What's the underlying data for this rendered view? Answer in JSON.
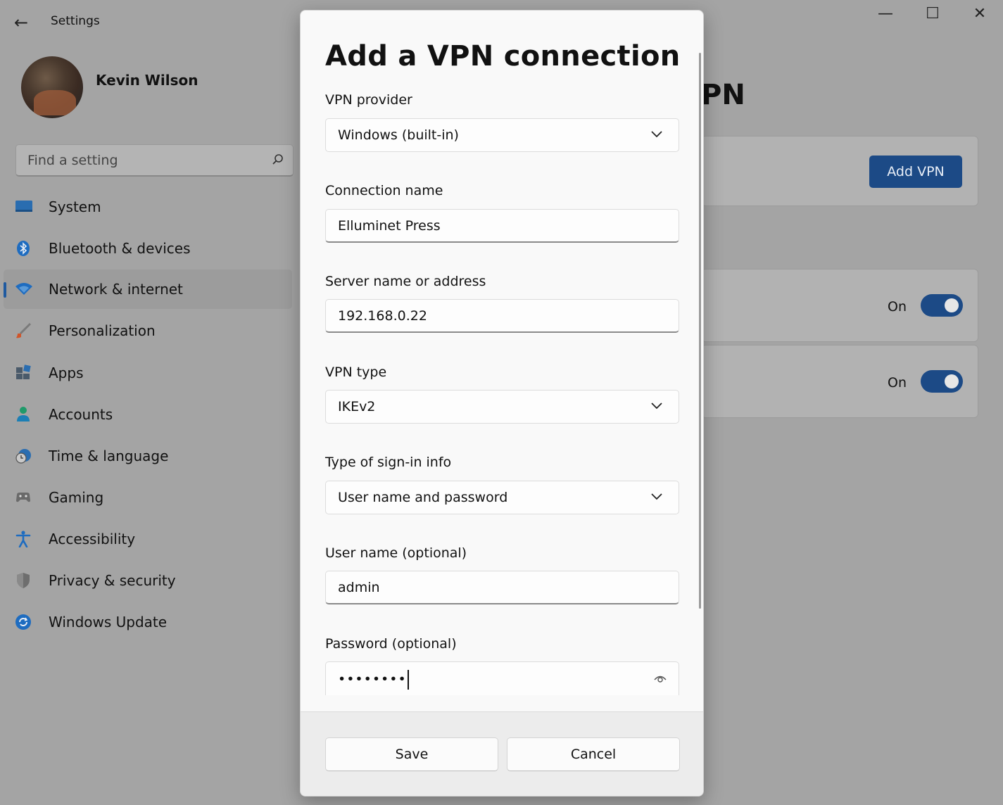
{
  "window": {
    "back_glyph": "←",
    "title": "Settings",
    "controls": {
      "minimize": "—",
      "maximize": "☐",
      "close": "✕"
    }
  },
  "profile": {
    "name": "Kevin Wilson"
  },
  "search": {
    "placeholder": "Find a setting",
    "icon": "search-icon"
  },
  "sidebar": {
    "items": [
      {
        "label": "System",
        "icon": "system-icon"
      },
      {
        "label": "Bluetooth & devices",
        "icon": "bluetooth-icon"
      },
      {
        "label": "Network & internet",
        "icon": "wifi-icon",
        "selected": true
      },
      {
        "label": "Personalization",
        "icon": "brush-icon"
      },
      {
        "label": "Apps",
        "icon": "apps-icon"
      },
      {
        "label": "Accounts",
        "icon": "account-icon"
      },
      {
        "label": "Time & language",
        "icon": "clock-globe-icon"
      },
      {
        "label": "Gaming",
        "icon": "gamepad-icon"
      },
      {
        "label": "Accessibility",
        "icon": "accessibility-icon"
      },
      {
        "label": "Privacy & security",
        "icon": "shield-icon"
      },
      {
        "label": "Windows Update",
        "icon": "update-icon"
      }
    ]
  },
  "background_page": {
    "title_fragment": "PN",
    "add_vpn_label": "Add VPN",
    "toggles": [
      {
        "label": "On",
        "on": true
      },
      {
        "label": "On",
        "on": true
      }
    ]
  },
  "dialog": {
    "title": "Add a VPN connection",
    "vpn_provider": {
      "label": "VPN provider",
      "value": "Windows (built-in)"
    },
    "connection_name": {
      "label": "Connection name",
      "value": "Elluminet Press"
    },
    "server": {
      "label": "Server name or address",
      "value": "192.168.0.22"
    },
    "vpn_type": {
      "label": "VPN type",
      "value": "IKEv2"
    },
    "signin_type": {
      "label": "Type of sign-in info",
      "value": "User name and password"
    },
    "username": {
      "label": "User name (optional)",
      "value": "admin"
    },
    "password": {
      "label": "Password (optional)",
      "value": "••••••••"
    },
    "save_label": "Save",
    "cancel_label": "Cancel"
  },
  "colors": {
    "accent": "#1c4a86",
    "dimmed_background": "#a4a4a4",
    "dialog_background": "#f9f9f9"
  }
}
